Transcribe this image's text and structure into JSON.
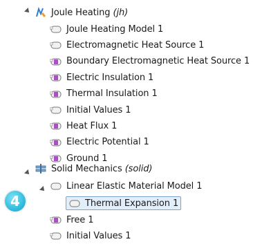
{
  "tree": {
    "joule": {
      "label": "Joule Heating",
      "tag": "(jh)"
    },
    "joule_children": [
      "Joule Heating Model 1",
      "Electromagnetic Heat Source 1",
      "Boundary Electromagnetic Heat Source 1",
      "Electric Insulation 1",
      "Thermal Insulation 1",
      "Initial Values 1",
      "Heat Flux 1",
      "Electric Potential 1",
      "Ground 1"
    ],
    "solid": {
      "label": "Solid Mechanics",
      "tag": "(solid)"
    },
    "linear_elastic": "Linear Elastic Material Model 1",
    "thermal_expansion": "Thermal Expansion 1",
    "solid_children": [
      "Free 1",
      "Initial Values 1"
    ]
  },
  "badge": {
    "number": "4",
    "color": "#29b6d8"
  },
  "icons": {
    "joule": "joule-heating-icon",
    "domain_node": "domain-node-icon",
    "boundary_node": "boundary-node-icon",
    "solid": "solid-mechanics-icon"
  }
}
